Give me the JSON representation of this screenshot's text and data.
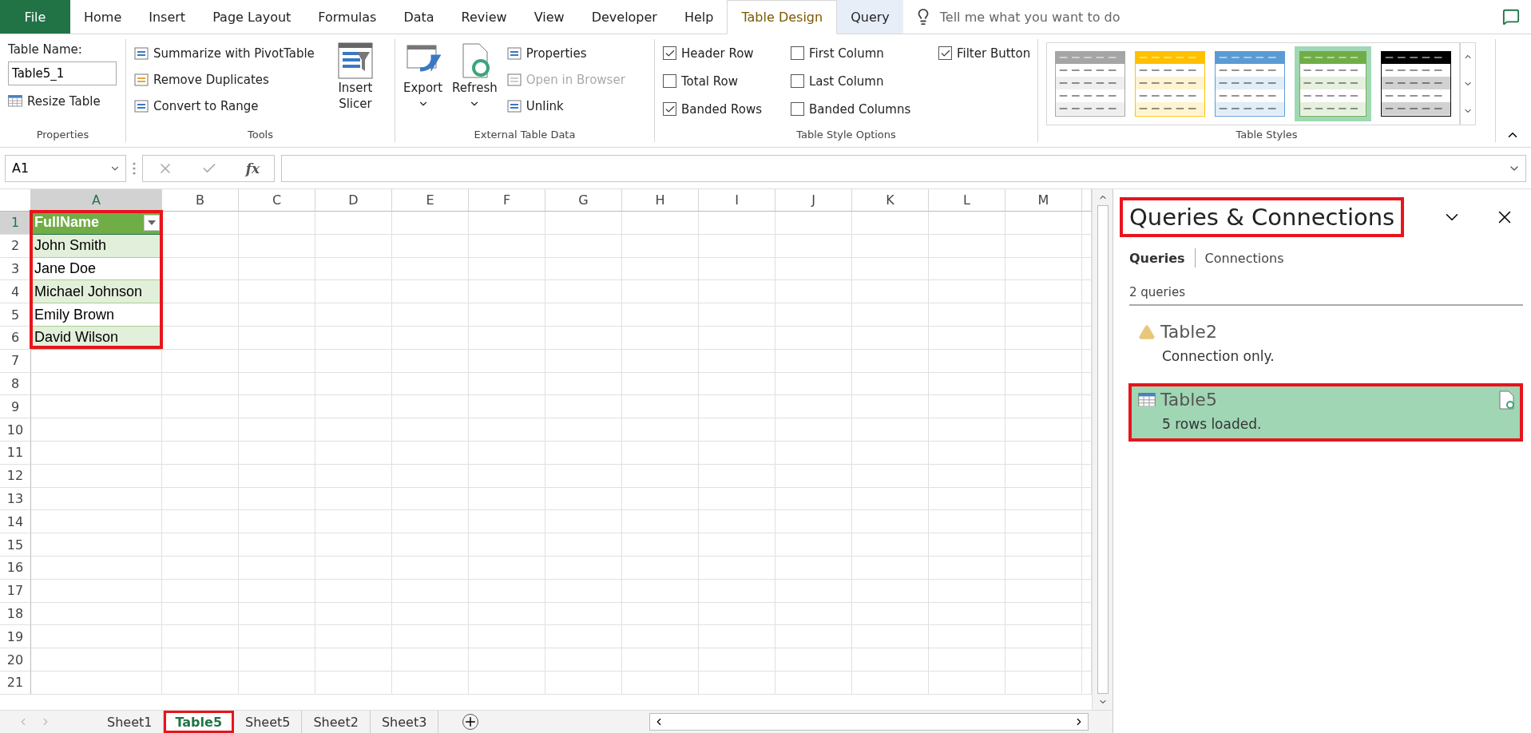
{
  "ribbon_tabs": [
    {
      "label": "File",
      "kind": "file",
      "selected": false
    },
    {
      "label": "Home",
      "kind": "normal",
      "selected": false
    },
    {
      "label": "Insert",
      "kind": "normal",
      "selected": false
    },
    {
      "label": "Page Layout",
      "kind": "normal",
      "selected": false
    },
    {
      "label": "Formulas",
      "kind": "normal",
      "selected": false
    },
    {
      "label": "Data",
      "kind": "normal",
      "selected": false
    },
    {
      "label": "Review",
      "kind": "normal",
      "selected": false
    },
    {
      "label": "View",
      "kind": "normal",
      "selected": false
    },
    {
      "label": "Developer",
      "kind": "normal",
      "selected": false
    },
    {
      "label": "Help",
      "kind": "normal",
      "selected": false
    },
    {
      "label": "Table Design",
      "kind": "contextual",
      "selected": true
    },
    {
      "label": "Query",
      "kind": "contextual",
      "selected": false
    }
  ],
  "tell_me": {
    "placeholder": "Tell me what you want to do"
  },
  "properties_group": {
    "label": "Properties",
    "table_name_label": "Table Name:",
    "table_name": "Table5_1",
    "resize": "Resize Table"
  },
  "tools_group": {
    "label": "Tools",
    "items": [
      "Summarize with PivotTable",
      "Remove Duplicates",
      "Convert to Range"
    ],
    "slicer": "Insert Slicer"
  },
  "external_group": {
    "label": "External Table Data",
    "big_buttons": [
      "Export",
      "Refresh"
    ],
    "items": [
      {
        "label": "Properties",
        "disabled": false
      },
      {
        "label": "Open in Browser",
        "disabled": true
      },
      {
        "label": "Unlink",
        "disabled": false
      }
    ]
  },
  "style_options": {
    "label": "Table Style Options",
    "options": [
      {
        "label": "Header Row",
        "checked": true
      },
      {
        "label": "Total Row",
        "checked": false
      },
      {
        "label": "Banded Rows",
        "checked": true
      },
      {
        "label": "First Column",
        "checked": false
      },
      {
        "label": "Last Column",
        "checked": false
      },
      {
        "label": "Banded Columns",
        "checked": false
      },
      {
        "label": "Filter Button",
        "checked": true
      }
    ]
  },
  "table_styles": {
    "label": "Table Styles",
    "styles": [
      {
        "color": "#a5a5a5",
        "selected": false
      },
      {
        "color": "#ffc000",
        "selected": false
      },
      {
        "color": "#5b9bd5",
        "selected": false
      },
      {
        "color": "#70ad47",
        "selected": true
      },
      {
        "color": "#000000",
        "selected": false
      }
    ]
  },
  "formula_bar": {
    "name_box": "A1",
    "fx": "fx"
  },
  "sheet": {
    "columns": [
      "A",
      "B",
      "C",
      "D",
      "E",
      "F",
      "G",
      "H",
      "I",
      "J",
      "K",
      "L",
      "M"
    ],
    "row_numbers": [
      "1",
      "2",
      "3",
      "4",
      "5",
      "6",
      "7",
      "8",
      "9",
      "10",
      "11",
      "12",
      "13",
      "14",
      "15",
      "16",
      "17",
      "18",
      "19",
      "20",
      "21"
    ],
    "table": {
      "highlighted": true,
      "header": "FullName",
      "rows": [
        "John Smith",
        "Jane Doe",
        "Michael Johnson",
        "Emily Brown",
        "David Wilson"
      ]
    }
  },
  "sheet_tabs": [
    {
      "label": "Sheet1",
      "selected": false,
      "highlighted": false
    },
    {
      "label": "Table5",
      "selected": true,
      "highlighted": true
    },
    {
      "label": "Sheet5",
      "selected": false,
      "highlighted": false
    },
    {
      "label": "Sheet2",
      "selected": false,
      "highlighted": false
    },
    {
      "label": "Sheet3",
      "selected": false,
      "highlighted": false
    }
  ],
  "pane": {
    "title": "Queries & Connections",
    "title_highlighted": true,
    "tabs": [
      {
        "label": "Queries",
        "selected": true
      },
      {
        "label": "Connections",
        "selected": false
      }
    ],
    "count": "2 queries",
    "queries": [
      {
        "name": "Table2",
        "status": "Connection only.",
        "kind": "warning",
        "selected": false,
        "highlighted": false
      },
      {
        "name": "Table5",
        "status": "5 rows loaded.",
        "kind": "table",
        "selected": true,
        "highlighted": true
      }
    ]
  }
}
